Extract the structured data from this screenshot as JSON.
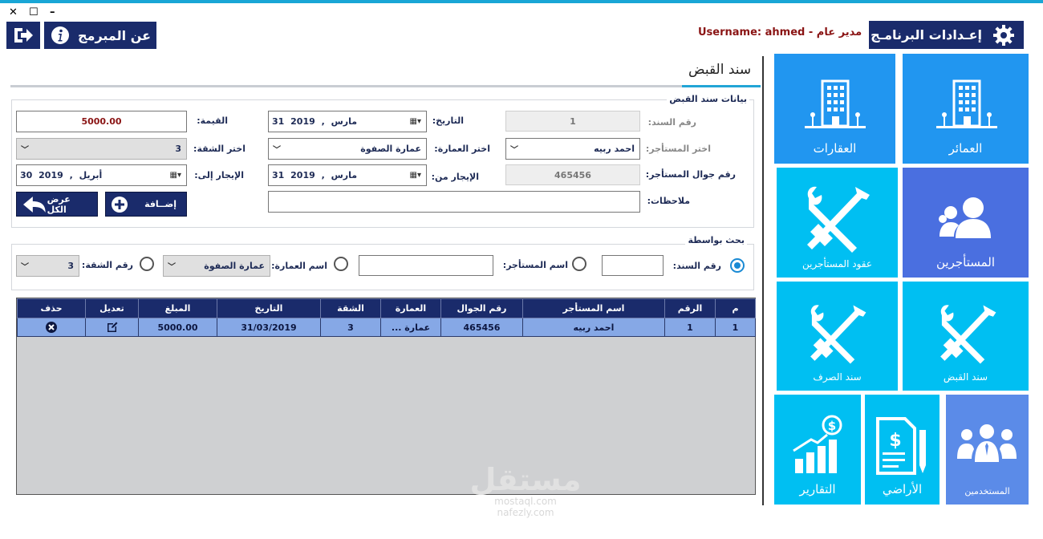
{
  "window": {
    "close": "✕",
    "maximize": "☐",
    "minimize": "–"
  },
  "header": {
    "settings_label": "إعـدادات البرنامـج",
    "about_label": "عن المبرمج",
    "user_info": "مدير عام - Username: ahmed"
  },
  "page": {
    "title": "سند القبض"
  },
  "receipt": {
    "legend": "بيانات سند القبض",
    "labels": {
      "voucher_no": "رقم السند:",
      "date": "التاريخ:",
      "value": "القيمة:",
      "tenant": "اختر المستأجر:",
      "building": "اختر العمارة:",
      "apartment": "اختر الشقة:",
      "mobile": "رقم جوال المستأجر:",
      "rent_from": "الإيجار من:",
      "rent_to": "الإيجار إلى:",
      "notes": "ملاحظات:"
    },
    "values": {
      "voucher_no": "1",
      "date": "31 مارس , 2019",
      "value": "5000.00",
      "tenant": "احمد ربيه",
      "building": "عمارة الصفوة",
      "apartment": "3",
      "mobile": "465456",
      "rent_from": "31 مارس , 2019",
      "rent_to": "30 أبريل , 2019",
      "notes": ""
    },
    "buttons": {
      "add": "إضــافة",
      "show_all": "عرض الكل"
    }
  },
  "search": {
    "legend": "بحث بواسطة",
    "options": {
      "voucher": "رقم السند:",
      "tenant": "اسم المستأجر:",
      "building": "اسم العمارة:",
      "apartment": "رقم الشقة:"
    },
    "selected": "voucher",
    "values": {
      "voucher": "",
      "tenant": "",
      "building": "عمارة الصفوة",
      "apartment": "3"
    }
  },
  "table": {
    "columns": [
      "م",
      "الرقم",
      "اسم المستأجر",
      "رقم الجوال",
      "العمارة",
      "الشقة",
      "التاريخ",
      "المبلغ",
      "تعديل",
      "حذف"
    ],
    "rows": [
      {
        "idx": "1",
        "no": "1",
        "tenant": "احمد ربيه",
        "mobile": "465456",
        "building": "عمارة ...",
        "apartment": "3",
        "date": "31/03/2019",
        "amount": "5000.00"
      }
    ]
  },
  "tiles": {
    "buildings": "العمائر",
    "properties": "العقارات",
    "tenants": "المستأجرين",
    "contracts": "عقود المستأجرين",
    "receipt": "سند القبض",
    "payment": "سند الصرف",
    "users": "المستخدمين",
    "lands": "الأراضي",
    "reports": "التقارير"
  },
  "watermark": {
    "big": "مستقل",
    "line1": "mostaql.com",
    "line2": "nafezly.com"
  },
  "colors": {
    "accent": "#19a6d6",
    "navy": "#1a2b6b",
    "tile_blue": "#2196f0",
    "tile_cyan": "#00bff2",
    "tile_purple": "#4a6fe0"
  }
}
